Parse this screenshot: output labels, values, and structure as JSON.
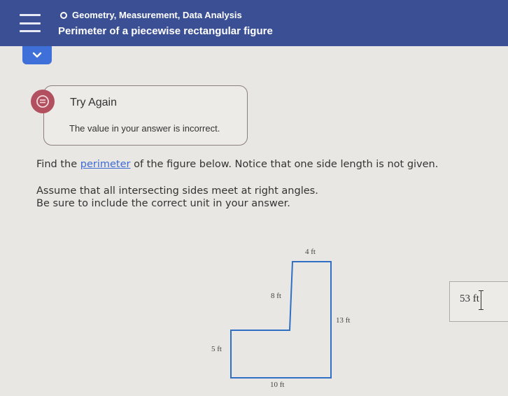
{
  "header": {
    "topic": "Geometry, Measurement, Data Analysis",
    "title": "Perimeter of a piecewise rectangular figure",
    "menu_icon": "hamburger-icon",
    "topic_icon": "circle-outline-icon"
  },
  "collapse": {
    "icon": "chevron-down-icon"
  },
  "feedback": {
    "icon": "speech-bubble-icon",
    "title": "Try Again",
    "message": "The value in your answer is incorrect."
  },
  "question": {
    "line1_before": "Find the ",
    "line1_link": "perimeter",
    "line1_after": " of the figure below. Notice that one side length is not given.",
    "line2": "Assume that all intersecting sides meet at right angles.",
    "line3": "Be sure to include the correct unit in your answer."
  },
  "figure": {
    "labels": {
      "top": "4 ft",
      "inner_vertical": "8 ft",
      "right": "13 ft",
      "left": "5 ft",
      "bottom": "10 ft"
    }
  },
  "answer": {
    "value": "53",
    "unit": "ft"
  },
  "colors": {
    "header_bg": "#3a4f94",
    "accent": "#3f6fd8",
    "feedback_icon": "#b2505f",
    "figure_line": "#2f6fc4"
  }
}
